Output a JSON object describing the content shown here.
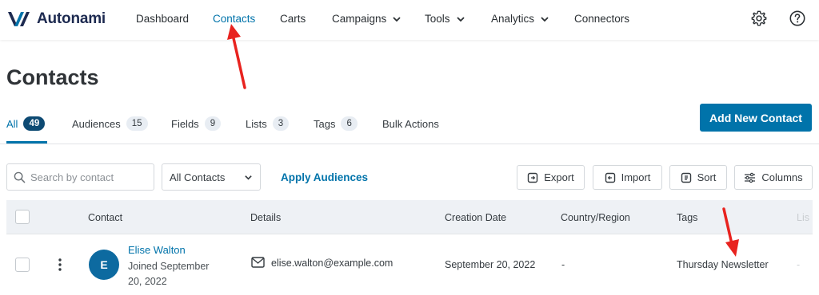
{
  "brand": {
    "name": "Autonami",
    "accent": "#0073aa",
    "dark": "#1d2a50"
  },
  "nav": {
    "items": [
      {
        "label": "Dashboard"
      },
      {
        "label": "Contacts"
      },
      {
        "label": "Carts"
      },
      {
        "label": "Campaigns"
      },
      {
        "label": "Tools"
      },
      {
        "label": "Analytics"
      },
      {
        "label": "Connectors"
      }
    ],
    "active": "Contacts",
    "icons": [
      "gear-icon",
      "help-icon"
    ]
  },
  "page": {
    "title": "Contacts"
  },
  "tabs": [
    {
      "label": "All",
      "count": "49"
    },
    {
      "label": "Audiences",
      "count": "15"
    },
    {
      "label": "Fields",
      "count": "9"
    },
    {
      "label": "Lists",
      "count": "3"
    },
    {
      "label": "Tags",
      "count": "6"
    },
    {
      "label": "Bulk Actions",
      "count": ""
    }
  ],
  "actions": {
    "add_contact": "Add New Contact"
  },
  "toolbar": {
    "search_placeholder": "Search by contact",
    "filter_value": "All Contacts",
    "apply_audiences": "Apply Audiences",
    "export": "Export",
    "import": "Import",
    "sort": "Sort",
    "columns": "Columns"
  },
  "table": {
    "headers": [
      "Contact",
      "Details",
      "Creation Date",
      "Country/Region",
      "Tags",
      "Lis"
    ],
    "rows": [
      {
        "avatar_initial": "E",
        "name": "Elise Walton",
        "joined": "Joined September 20, 2022",
        "email": "elise.walton@example.com",
        "creation_date": "September 20, 2022",
        "country": "-",
        "tags": "Thursday Newsletter",
        "lists": "-"
      }
    ]
  },
  "annotation_color": "#e8231f"
}
